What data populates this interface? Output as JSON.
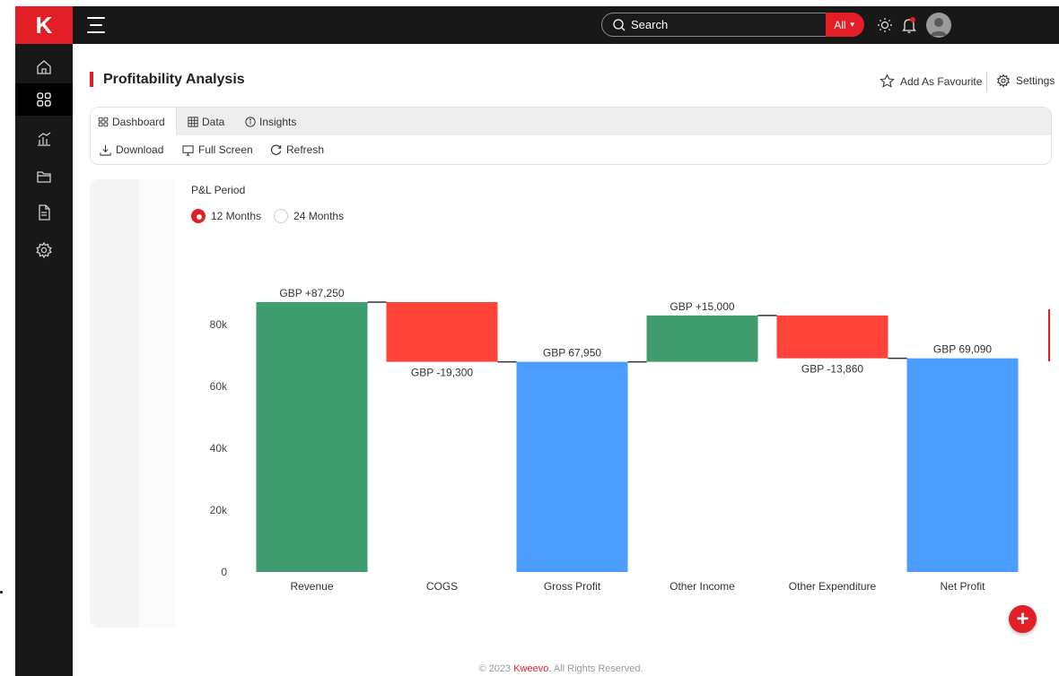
{
  "app": {
    "logo_text": "K",
    "brand_color": "#e41e26"
  },
  "search": {
    "placeholder": "Search",
    "scope_label": "All"
  },
  "sidebar": {
    "items": [
      {
        "name": "home",
        "icon": "home-icon"
      },
      {
        "name": "dashboard",
        "icon": "grid-icon",
        "active": true
      },
      {
        "name": "analytics",
        "icon": "chart-icon"
      },
      {
        "name": "folder",
        "icon": "folder-icon"
      },
      {
        "name": "report",
        "icon": "document-icon"
      },
      {
        "name": "settings",
        "icon": "gear-icon"
      }
    ]
  },
  "header": {
    "title": "Profitability Analysis",
    "favourite_label": "Add As Favourite",
    "settings_label": "Settings"
  },
  "tabs": [
    {
      "label": "Dashboard",
      "icon": "grid-icon",
      "active": true
    },
    {
      "label": "Data",
      "icon": "table-icon",
      "active": false
    },
    {
      "label": "Insights",
      "icon": "info-icon",
      "active": false
    }
  ],
  "toolbar": {
    "download_label": "Download",
    "fullscreen_label": "Full Screen",
    "refresh_label": "Refresh"
  },
  "filter": {
    "label": "P&L Period",
    "options": [
      {
        "label": "12 Months",
        "selected": true
      },
      {
        "label": "24 Months",
        "selected": false
      }
    ]
  },
  "chart_data": {
    "type": "bar",
    "subtype": "waterfall",
    "categories": [
      "Revenue",
      "COGS",
      "Gross Profit",
      "Other Income",
      "Other Expenditure",
      "Net Profit"
    ],
    "bars": [
      {
        "category": "Revenue",
        "start": 0,
        "end": 87250,
        "label": "GBP +87,250",
        "color": "#3e9c6f",
        "label_pos": "top"
      },
      {
        "category": "COGS",
        "start": 87250,
        "end": 67950,
        "label": "GBP -19,300",
        "color": "#ff4338",
        "label_pos": "bottom"
      },
      {
        "category": "Gross Profit",
        "start": 0,
        "end": 67950,
        "label": "GBP 67,950",
        "color": "#4a9cff",
        "label_pos": "top"
      },
      {
        "category": "Other Income",
        "start": 67950,
        "end": 82950,
        "label": "GBP +15,000",
        "color": "#3e9c6f",
        "label_pos": "top"
      },
      {
        "category": "Other Expenditure",
        "start": 82950,
        "end": 69090,
        "label": "GBP -13,860",
        "color": "#ff4338",
        "label_pos": "bottom"
      },
      {
        "category": "Net Profit",
        "start": 0,
        "end": 69090,
        "label": "GBP 69,090",
        "color": "#4a9cff",
        "label_pos": "top"
      }
    ],
    "y_ticks": [
      {
        "value": 0,
        "label": "0"
      },
      {
        "value": 20000,
        "label": "20k"
      },
      {
        "value": 40000,
        "label": "40k"
      },
      {
        "value": 60000,
        "label": "60k"
      },
      {
        "value": 80000,
        "label": "80k"
      }
    ],
    "ylim": [
      0,
      87250
    ],
    "grid": false,
    "connector_color": "#333333"
  },
  "footer": {
    "prefix": "© 2023 ",
    "brand": "Kweevo",
    "suffix": ". All Rights Reserved."
  }
}
